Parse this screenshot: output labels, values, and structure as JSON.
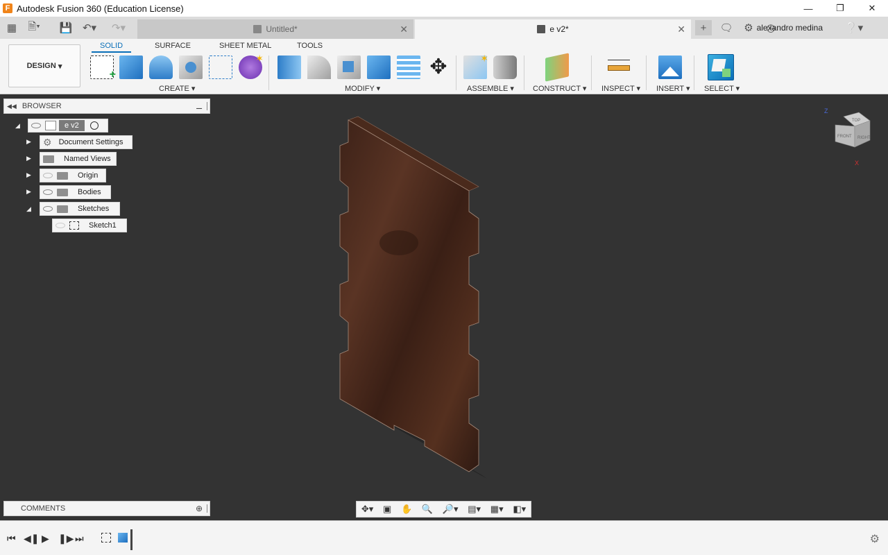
{
  "window": {
    "title": "Autodesk Fusion 360 (Education License)",
    "logo_letter": "F"
  },
  "tabs": [
    {
      "label": "Untitled*",
      "state": "inactive"
    },
    {
      "label": "e v2*",
      "state": "active"
    }
  ],
  "user": {
    "name": "alexandro medina"
  },
  "toolbar": {
    "design_label": "DESIGN",
    "workspace_tabs": [
      "SOLID",
      "SURFACE",
      "SHEET METAL",
      "TOOLS"
    ],
    "groups": [
      "CREATE",
      "MODIFY",
      "ASSEMBLE",
      "CONSTRUCT",
      "INSPECT",
      "INSERT",
      "SELECT"
    ]
  },
  "browser": {
    "title": "BROWSER",
    "root": "e v2",
    "items": [
      "Document Settings",
      "Named Views",
      "Origin",
      "Bodies",
      "Sketches"
    ],
    "sketch": "Sketch1"
  },
  "comments": {
    "title": "COMMENTS"
  },
  "viewcube": {
    "top": "TOP",
    "front": "FRONT",
    "right": "RIGHT",
    "axis_x": "X",
    "axis_z": "Z"
  },
  "colors": {
    "accent": "#0a6fb8",
    "viewport": "#333333",
    "wood": "#4a2a1c"
  }
}
